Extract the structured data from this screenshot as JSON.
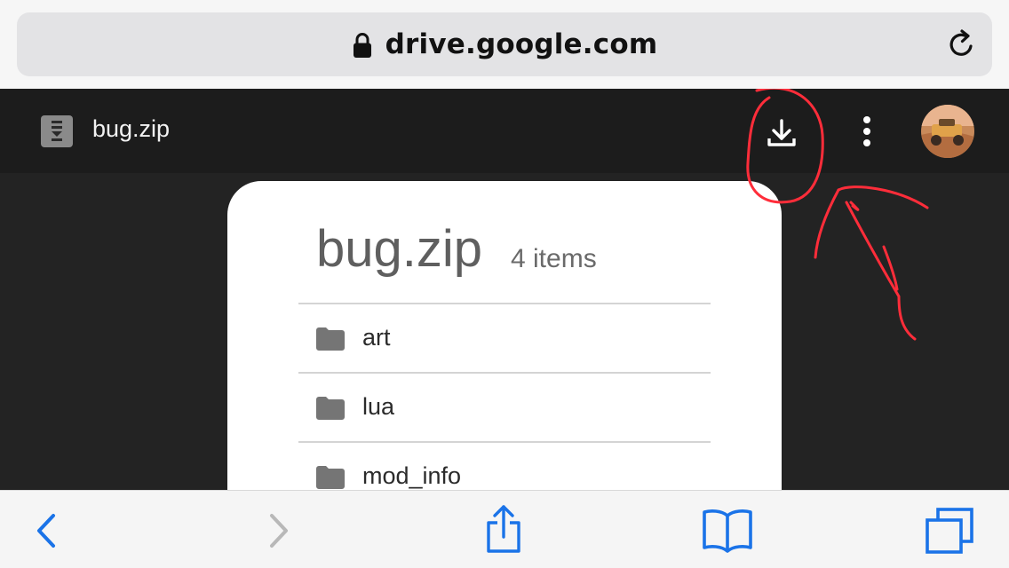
{
  "browser": {
    "url": "drive.google.com",
    "icons": {
      "lock": "lock-icon",
      "reload": "reload-icon"
    }
  },
  "drive": {
    "file_name": "bug.zip",
    "header_icons": [
      "file-icon",
      "download-icon",
      "more-vert-icon",
      "avatar"
    ],
    "card": {
      "title": "bug.zip",
      "item_count": "4 items",
      "items": [
        {
          "label": "art",
          "icon": "folder-icon"
        },
        {
          "label": "lua",
          "icon": "folder-icon"
        },
        {
          "label": "mod_info",
          "icon": "folder-icon"
        }
      ]
    }
  },
  "toolbar": {
    "buttons": [
      "back-icon",
      "forward-icon",
      "share-icon",
      "bookmarks-icon",
      "tabs-icon"
    ],
    "accent_color": "#1a73e8",
    "disabled_color": "#b8b8b8"
  },
  "annotation": {
    "color": "#ff2d3a",
    "description_icon": "circle-and-arrow-annotation"
  }
}
